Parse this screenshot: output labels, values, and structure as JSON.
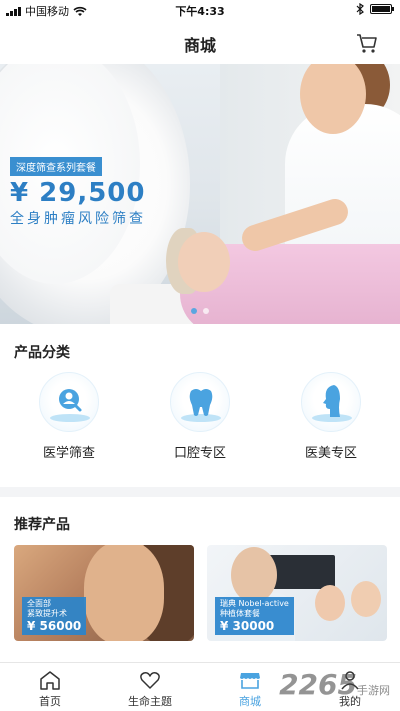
{
  "status_bar": {
    "carrier": "中国移动",
    "time": "下午4:33"
  },
  "nav": {
    "title": "商城",
    "icon": "cart-icon"
  },
  "banner": {
    "tag": "深度筛查系列套餐",
    "price": "¥ 29,500",
    "subtitle": "全身肿瘤风险筛查",
    "dots": 2,
    "active_dot": 0
  },
  "categories": {
    "title": "产品分类",
    "items": [
      {
        "label": "医学筛查",
        "icon": "search-person-icon"
      },
      {
        "label": "口腔专区",
        "icon": "tooth-icon"
      },
      {
        "label": "医美专区",
        "icon": "face-profile-icon"
      }
    ]
  },
  "recommended": {
    "title": "推荐产品",
    "items": [
      {
        "line1": "全面部",
        "line2": "紧致提升术",
        "price": "¥ 56000"
      },
      {
        "line1": "瑞典 Nobel-active",
        "line2": "种植体套餐",
        "price": "¥ 30000"
      }
    ]
  },
  "tabbar": {
    "items": [
      {
        "label": "首页",
        "icon": "home-icon"
      },
      {
        "label": "生命主题",
        "icon": "heart-icon"
      },
      {
        "label": "商城",
        "icon": "shop-icon"
      },
      {
        "label": "我的",
        "icon": "user-icon"
      }
    ],
    "active_index": 2
  },
  "watermark": {
    "logo": "2265",
    "text": "手游网",
    "domain": ".com"
  },
  "colors": {
    "accent": "#4aa3e0",
    "banner_text": "#2d7fc4"
  }
}
